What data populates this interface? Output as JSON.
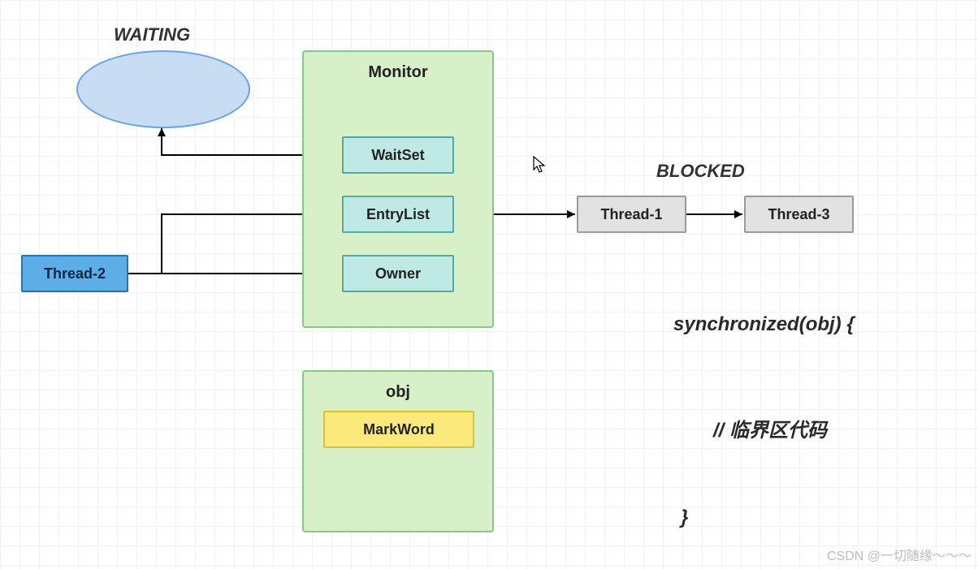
{
  "labels": {
    "waiting": "WAITING",
    "blocked": "BLOCKED"
  },
  "monitor": {
    "title": "Monitor",
    "waitset": "WaitSet",
    "entrylist": "EntryList",
    "owner": "Owner"
  },
  "obj": {
    "title": "obj",
    "markword": "MarkWord"
  },
  "threads": {
    "t2": "Thread-2",
    "t1": "Thread-1",
    "t3": "Thread-3"
  },
  "code": {
    "line1": "synchronized(obj) {",
    "line2": "// 临界区代码",
    "line3": "}"
  },
  "watermark": "CSDN @一切随缘～～～",
  "colors": {
    "ellipse_fill": "#c8ddf4",
    "ellipse_stroke": "#6aa3e6",
    "green_fill": "#d8f0c8",
    "green_stroke": "#86c984",
    "teal_fill": "#bfe9e4",
    "teal_stroke": "#57a9a0",
    "blue_fill": "#5dade7",
    "blue_stroke": "#2d6fb5",
    "gray_fill": "#e2e2e2",
    "gray_stroke": "#9a9a9a",
    "yellow_fill": "#fbe97c",
    "yellow_stroke": "#d8c23b"
  }
}
